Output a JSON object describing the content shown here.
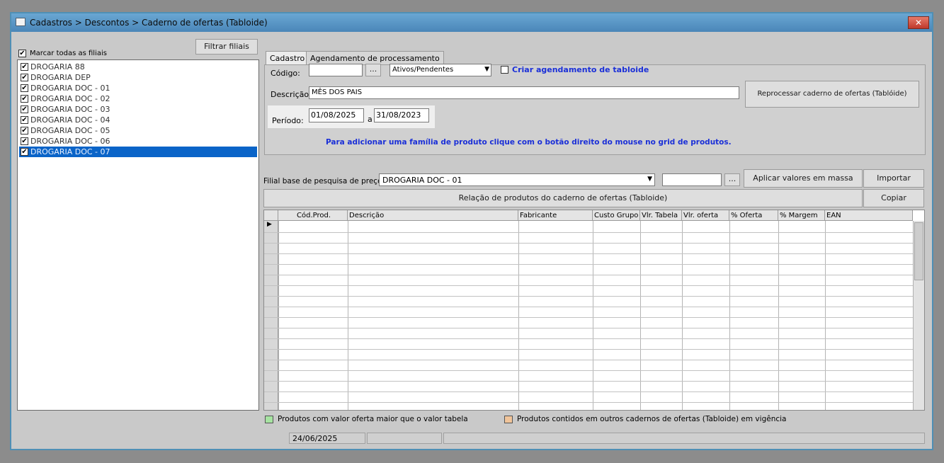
{
  "window": {
    "title": "Cadastros > Descontos > Caderno de ofertas (Tabloide)",
    "close": "✕"
  },
  "left": {
    "filter_button": "Filtrar filiais",
    "mark_all": "Marcar todas as filiais",
    "branches": [
      {
        "label": "DROGARIA 88",
        "checked": true
      },
      {
        "label": "DROGARIA DEP",
        "checked": true
      },
      {
        "label": "DROGARIA DOC - 01",
        "checked": true
      },
      {
        "label": "DROGARIA DOC - 02",
        "checked": true
      },
      {
        "label": "DROGARIA DOC - 03",
        "checked": true
      },
      {
        "label": "DROGARIA DOC - 04",
        "checked": true
      },
      {
        "label": "DROGARIA DOC - 05",
        "checked": true
      },
      {
        "label": "DROGARIA DOC - 06",
        "checked": true
      },
      {
        "label": "DROGARIA DOC - 07",
        "checked": true,
        "selected": true
      }
    ]
  },
  "tabs": [
    "Cadastro",
    "Agendamento de processamento"
  ],
  "cadastro": {
    "codigo_label": "Código:",
    "codigo_value": "",
    "ellipsis": "...",
    "status_select": "Ativos/Pendentes",
    "schedule_checkbox": "Criar agendamento de tabloide",
    "descricao_label": "Descrição:",
    "descricao_value": "MÊS DOS PAIS",
    "reprocess_button": "Reprocessar caderno de ofertas (Tablóide)",
    "periodo_label": "Período:",
    "date_from": "01/08/2025",
    "date_sep": "a",
    "date_to": "31/08/2023",
    "hint": "Para adicionar uma família de produto clique com o botão direito do  mouse no grid de produtos."
  },
  "pricing": {
    "base_label": "Filial base de pesquisa de preço",
    "base_value": "DROGARIA DOC - 01",
    "extra_value": "",
    "ellipsis": "...",
    "apply_button": "Aplicar valores em massa",
    "import_button": "Importar",
    "copy_button": "Copiar",
    "relation_button": "Relação de produtos do caderno de ofertas (Tabloide)"
  },
  "grid": {
    "columns": [
      "Cód.Prod.",
      "Descrição",
      "Fabricante",
      "Custo Grupo",
      "Vlr. Tabela",
      "Vlr. oferta",
      "% Oferta",
      "% Margem",
      "EAN"
    ],
    "row_indicator": "▶"
  },
  "legend": {
    "green_label": "Produtos com valor oferta maior que o valor tabela",
    "green_color": "#a6e3a1",
    "orange_label": "Produtos contidos em outros cadernos de ofertas (Tabloide) em vigência",
    "orange_color": "#f0c49a"
  },
  "status": {
    "date": "24/06/2025"
  },
  "icons": {
    "select_arrow": "▼",
    "check": "✔"
  }
}
